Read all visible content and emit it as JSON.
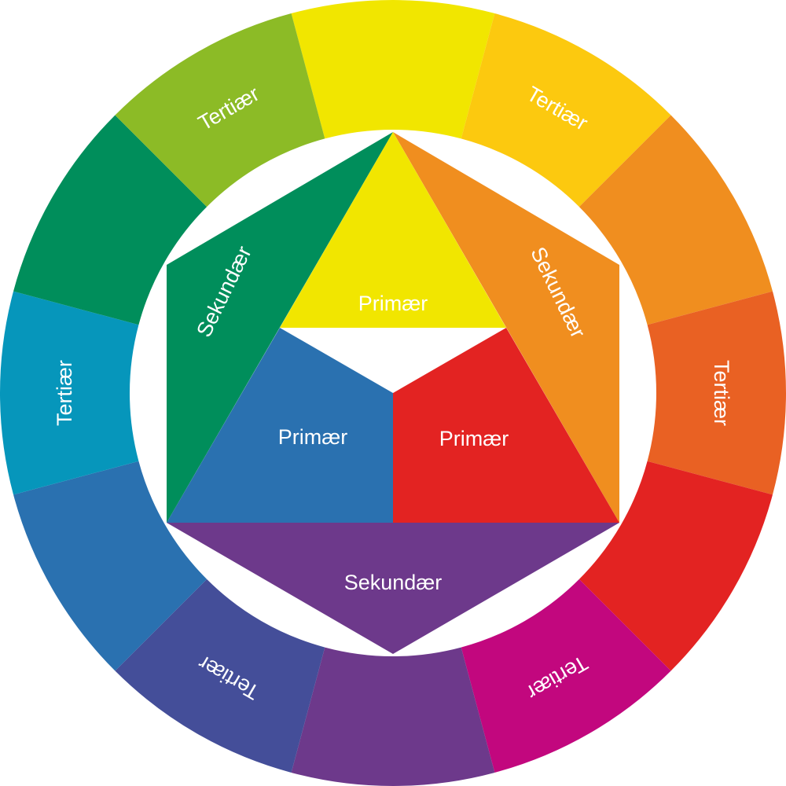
{
  "ring": {
    "segments": [
      {
        "color": "#F1E600",
        "label": ""
      },
      {
        "color": "#FCC90F",
        "label": "Tertiær"
      },
      {
        "color": "#F08E1F",
        "label": ""
      },
      {
        "color": "#E96123",
        "label": "Tertiær"
      },
      {
        "color": "#E32322",
        "label": ""
      },
      {
        "color": "#C2077E",
        "label": "Tertiær"
      },
      {
        "color": "#6D398B",
        "label": ""
      },
      {
        "color": "#444E99",
        "label": "Tertiær"
      },
      {
        "color": "#2A71B0",
        "label": ""
      },
      {
        "color": "#0696BB",
        "label": "Tertiær"
      },
      {
        "color": "#008E5B",
        "label": ""
      },
      {
        "color": "#8CBB26",
        "label": "Tertiær"
      }
    ]
  },
  "center": {
    "primary": [
      {
        "name": "yellow",
        "color": "#F1E600",
        "label": "Primær"
      },
      {
        "name": "red",
        "color": "#E32322",
        "label": "Primær"
      },
      {
        "name": "blue",
        "color": "#2A71B0",
        "label": "Primær"
      }
    ],
    "secondary": [
      {
        "name": "orange",
        "color": "#F08E1F",
        "label": "Sekundær"
      },
      {
        "name": "violet",
        "color": "#6D398B",
        "label": "Sekundær"
      },
      {
        "name": "green",
        "color": "#008E5B",
        "label": "Sekundær"
      }
    ]
  }
}
